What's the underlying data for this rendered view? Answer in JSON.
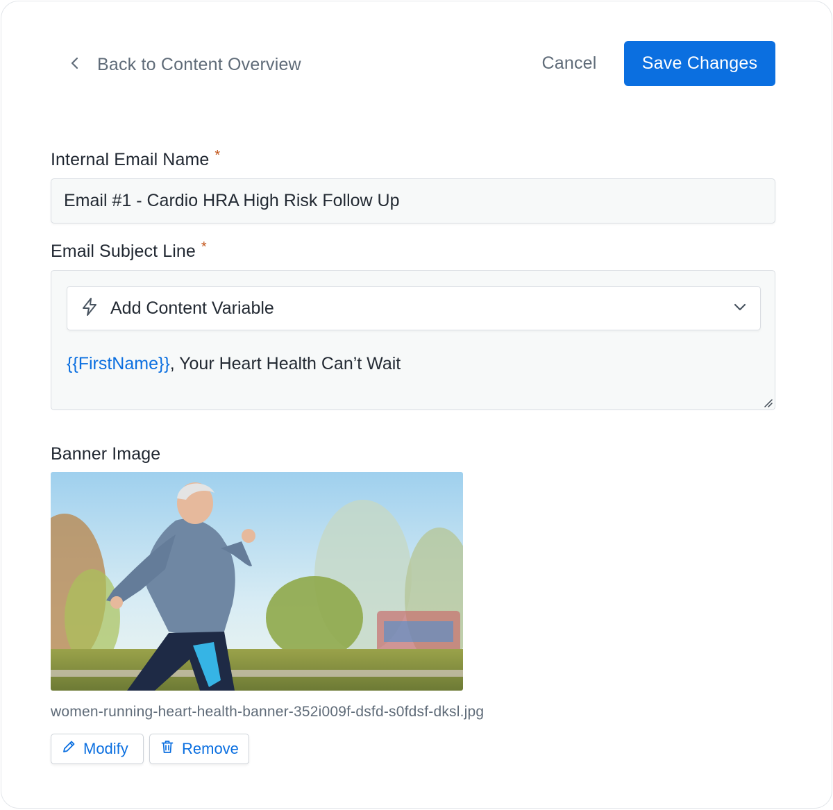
{
  "header": {
    "back_label": "Back to Content Overview",
    "cancel_label": "Cancel",
    "save_label": "Save Changes"
  },
  "form": {
    "email_name": {
      "label": "Internal Email Name",
      "required_marker": "*",
      "value": "Email #1 - Cardio HRA High Risk Follow Up"
    },
    "subject": {
      "label": "Email Subject Line",
      "required_marker": "*",
      "variable_dropdown_label": "Add Content Variable",
      "variable_token": "{{FirstName}}",
      "text_after_variable": ", Your Heart Health Can’t Wait"
    },
    "banner": {
      "label": "Banner Image",
      "file_name": "women-running-heart-health-banner-352i009f-dsfd-s0fdsf-dksl.jpg",
      "modify_label": "Modify",
      "remove_label": "Remove"
    }
  },
  "icons": {
    "back": "chevron-left-icon",
    "variable": "lightning-bolt-icon",
    "dropdown": "chevron-down-icon",
    "modify": "pencil-icon",
    "remove": "trash-icon"
  },
  "colors": {
    "accent": "#0b6fe0",
    "required": "#c25418",
    "muted_text": "#5f6b78",
    "field_background": "#f7f9f9"
  }
}
